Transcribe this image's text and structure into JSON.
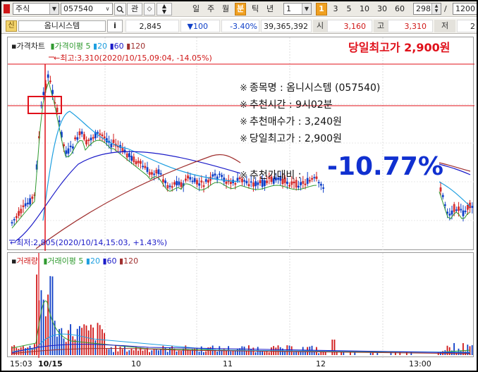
{
  "toolbar": {
    "market_select": "주식",
    "code_input": "057540",
    "period_buttons": [
      "일",
      "주",
      "월",
      "분",
      "틱",
      "년"
    ],
    "selected_period": "분",
    "interval_select": "1",
    "interval_indicator": "1",
    "interval_buttons": [
      "3",
      "5",
      "10",
      "30",
      "60"
    ],
    "count_input": "298",
    "count_separator": "/",
    "count_total": "1200",
    "related_button": "관"
  },
  "stock_bar": {
    "badge": "신",
    "name": "옴니시스템",
    "info_button": "i",
    "price": "2,845",
    "change": "▼100",
    "change_pct": "-3.40%",
    "volume": "39,365,392",
    "open_label": "시",
    "open": "3,160",
    "high_label": "고",
    "high": "3,310",
    "low_label": "저",
    "low": "2"
  },
  "price_panel": {
    "legend": {
      "title": "가격차트",
      "ma_label": "가격이평",
      "ma_periods": [
        "5",
        "20",
        "60",
        "120"
      ]
    },
    "high_marker": "←최고:3,310(2020/10/15,09:04, -14.05%)",
    "low_marker": "←최저:2,805(2020/10/14,15:03, +1.43%)",
    "daily_high_banner": "당일최고가 2,900원"
  },
  "annotation": {
    "mark": "※",
    "lines": [
      "종목명 : 옴니시스템 (057540)",
      "추천시간 : 9시02분",
      "추천매수가 : 3,240원",
      "당일최고가 : 2,900원"
    ],
    "compare_label": "추천가대비 :",
    "compare_value": "-10.77%"
  },
  "volume_panel": {
    "legend": {
      "title": "거래량",
      "ma_label": "거래이평",
      "ma_periods": [
        "5",
        "20",
        "60",
        "120"
      ]
    }
  },
  "x_axis": {
    "labels": [
      "15:03",
      "10/15",
      "10",
      "11",
      "12",
      "13:00"
    ]
  },
  "colors": {
    "ma5": "#2f9a2f",
    "ma20": "#1e9fe0",
    "ma60": "#1a1ac8",
    "ma120": "#a0302f",
    "up": "#d01818",
    "down": "#1040c8",
    "banner": "#e0101a",
    "compare": "#1030d0",
    "selected_period": "#f0a020"
  },
  "icons": {
    "search": "search-icon",
    "dropdown": "chevron-down-icon",
    "spinner": "spinner-icon"
  }
}
